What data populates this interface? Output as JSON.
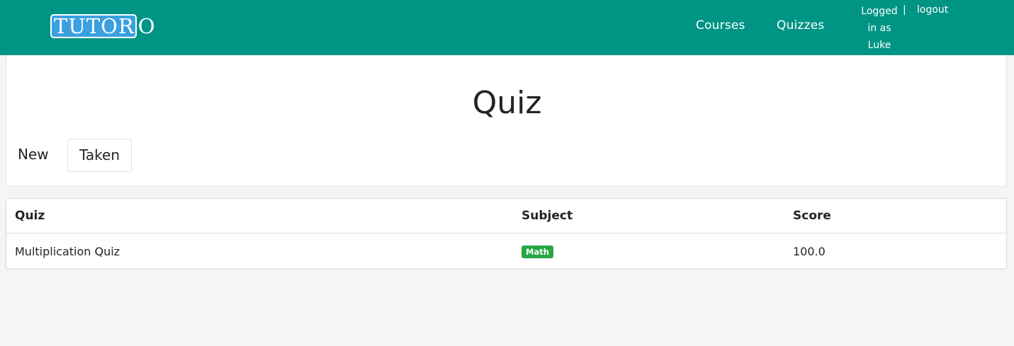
{
  "nav": {
    "logo_boxed": "TUTOR",
    "logo_tail": "O",
    "links": {
      "courses": "Courses",
      "quizzes": "Quizzes"
    },
    "user": {
      "line1": "Logged",
      "line2": "in as",
      "line3": "Luke",
      "separator": "|",
      "logout": "logout"
    }
  },
  "page": {
    "title": "Quiz",
    "tabs": {
      "new": "New",
      "taken": "Taken"
    }
  },
  "table": {
    "headers": [
      "Quiz",
      "Subject",
      "Score"
    ],
    "rows": [
      {
        "quiz": "Multiplication Quiz",
        "subject": "Math",
        "score": "100.0"
      }
    ]
  },
  "colors": {
    "navbar": "#009485",
    "logo_box": "#3aa0e0",
    "badge": "#28a745",
    "background": "#f4f5f7"
  }
}
